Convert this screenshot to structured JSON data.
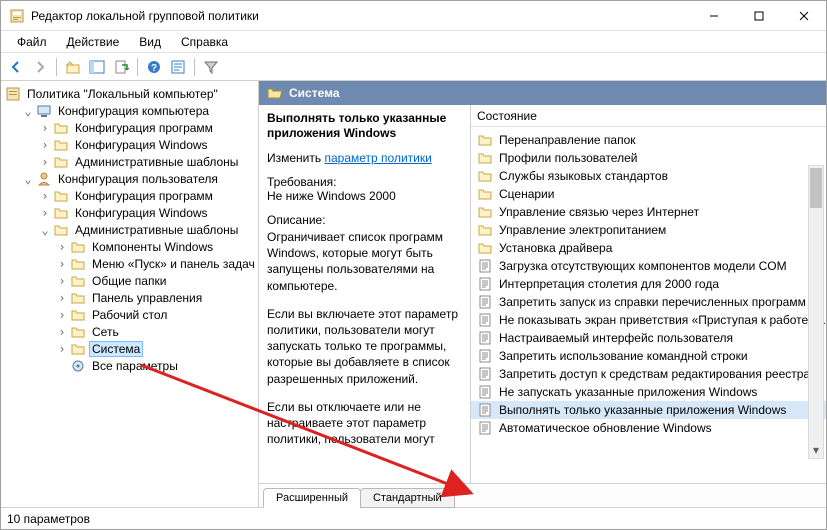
{
  "window": {
    "title": "Редактор локальной групповой политики"
  },
  "menu": [
    "Файл",
    "Действие",
    "Вид",
    "Справка"
  ],
  "tree": {
    "root": "Политика \"Локальный компьютер\"",
    "computer": {
      "label": "Конфигурация компьютера",
      "children": [
        "Конфигурация программ",
        "Конфигурация Windows",
        "Административные шаблоны"
      ]
    },
    "user": {
      "label": "Конфигурация пользователя",
      "children": [
        "Конфигурация программ",
        "Конфигурация Windows"
      ],
      "templates": {
        "label": "Административные шаблоны",
        "children": [
          "Компоненты Windows",
          "Меню «Пуск» и панель задач",
          "Общие папки",
          "Панель управления",
          "Рабочий стол",
          "Сеть",
          "Система"
        ],
        "all": "Все параметры"
      }
    }
  },
  "header": {
    "title": "Система"
  },
  "details": {
    "title": "Выполнять только указанные приложения Windows",
    "edit_prefix": "Изменить",
    "edit_link": "параметр политики",
    "req_label": "Требования:",
    "req_text": "Не ниже Windows 2000",
    "desc_label": "Описание:",
    "desc1": "Ограничивает список программ Windows, которые могут быть запущены пользователями на компьютере.",
    "desc2": "Если вы включаете этот параметр политики, пользователи могут запускать только те программы, которые вы добавляете в список разрешенных приложений.",
    "desc3": "Если вы отключаете или не настраиваете этот параметр политики, пользователи могут"
  },
  "list": {
    "column": "Состояние",
    "folders": [
      "Перенаправление папок",
      "Профили пользователей",
      "Службы языковых стандартов",
      "Сценарии",
      "Управление связью через Интернет",
      "Управление электропитанием",
      "Установка драйвера"
    ],
    "items": [
      "Загрузка отсутствующих компонентов модели COM",
      "Интерпретация столетия для 2000 года",
      "Запретить запуск из справки перечисленных программ",
      "Не показывать экран приветствия «Приступая к работе» …",
      "Настраиваемый интерфейс пользователя",
      "Запретить использование командной строки",
      "Запретить доступ к средствам редактирования реестра",
      "Не запускать указанные приложения Windows",
      "Выполнять только указанные приложения Windows",
      "Автоматическое обновление Windows"
    ],
    "highlight_index": 8
  },
  "tabs": [
    "Расширенный",
    "Стандартный"
  ],
  "status": "10 параметров"
}
